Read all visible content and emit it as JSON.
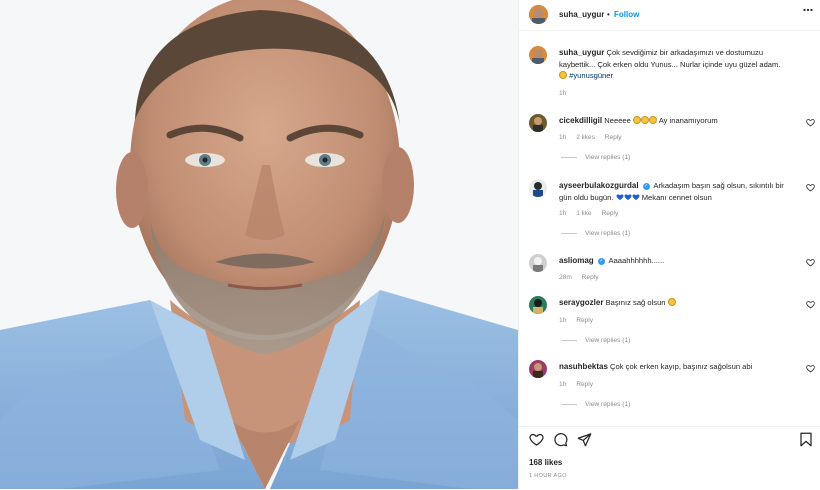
{
  "post": {
    "username": "suha_uygur",
    "dot": "•",
    "follow_label": "Follow",
    "more_label": "•••",
    "caption_text": "Çok sevdiğimiz bir arkadaşımızı ve dostumuzu kaybettik... Çok erken oldu Yunus... Nurlar içinde uyu güzel adam.",
    "caption_hashtag": "#yunusgüner",
    "caption_time": "1h",
    "likes": "168 likes",
    "time_ago": "1 HOUR AGO"
  },
  "comments": [
    {
      "user": "cicekdilligil",
      "text": "Neeeee",
      "time": "1h",
      "likes": "2 likes",
      "reply": "Reply",
      "view_replies": "View replies (1)"
    },
    {
      "user": "ayseerbulakozgurdal",
      "text": "Arkadaşım başın sağ olsun, sıkıntılı bir gün oldu bugün.",
      "text2": "Mekanı cennet olsun",
      "time": "1h",
      "likes": "1 like",
      "reply": "Reply",
      "view_replies": "View replies (1)"
    },
    {
      "user": "asliomag",
      "text": "Aaaahhhhhh......",
      "time": "28m",
      "reply": "Reply"
    },
    {
      "user": "seraygozler",
      "text": "Başınız sağ olsun",
      "time": "1h",
      "reply": "Reply",
      "view_replies": "View replies (1)"
    },
    {
      "user": "nasuhbektas",
      "text": "Çok çok erken kayıp, başınız sağolsun abi",
      "time": "1h",
      "reply": "Reply",
      "view_replies": "View replies (1)"
    }
  ],
  "colors": {
    "accent": "#0095f6",
    "verified": "#3897f0",
    "muted": "#8e8e8e",
    "heart_emoji": "#1e5bd6"
  },
  "icons": [
    "heart-icon",
    "comment-icon",
    "share-icon",
    "bookmark-icon",
    "more-icon",
    "verified-icon"
  ]
}
